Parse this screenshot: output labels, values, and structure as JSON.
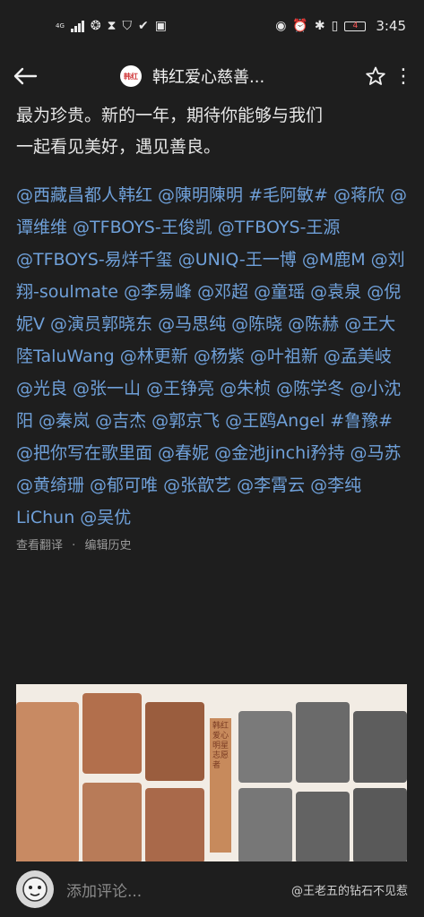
{
  "status": {
    "network": "4G",
    "time": "3:45",
    "battery": "4"
  },
  "header": {
    "avatar_text": "韩红",
    "title": "韩红爱心慈善..."
  },
  "post": {
    "text_line1": "最为珍贵。新的一年，期待你能够与我们",
    "text_line2": "一起看见美好，遇见善良。",
    "mentions": "@西藏昌都人韩红 @陳明陳明 #毛阿敏# @蒋欣 @谭维维 @TFBOYS-王俊凯 @TFBOYS-王源 @TFBOYS-易烊千玺 @UNIQ-王一博 @M鹿M @刘翔-soulmate @李易峰 @邓超 @童瑶 @袁泉 @倪妮V @演员郭晓东 @马思纯 @陈晓 @陈赫 @王大陸TaluWang @林更新 @杨紫 @叶祖新 @孟美岐 @光良 @张一山 @王铮亮 @朱桢 @陈学冬 @小沈阳 @秦岚 @吉杰 @郭京飞 @王鸥Angel #鲁豫# @把你写在歌里面 @春妮 @金池jinchi矜持 @马苏 @黄绮珊 @郁可唯 @张歆艺 @李霄云 @李纯LiChun @吴优",
    "translate_label": "查看翻译",
    "history_label": "编辑历史",
    "separator": "·",
    "poster_vertical_text": "韩红爱心明星志愿者"
  },
  "comment": {
    "placeholder": "添加评论...",
    "watermark": "@王老五的钻石不见惹"
  },
  "colors": {
    "background": "#1e1e1e",
    "link": "#6fa0d9",
    "text": "#e6e6e6"
  }
}
